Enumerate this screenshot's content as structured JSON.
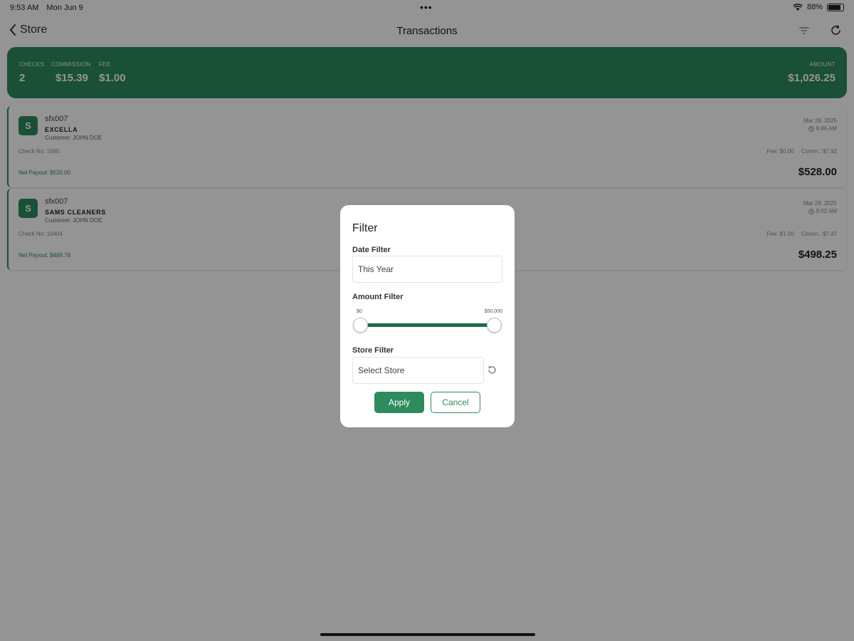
{
  "status": {
    "time": "9:53 AM",
    "date": "Mon Jun 9",
    "battery": "88%"
  },
  "nav": {
    "back_label": "Store",
    "title": "Transactions"
  },
  "summary": {
    "checks_label": "CHECKS",
    "checks": "2",
    "commission_label": "COMMISSION",
    "commission": "$15.39",
    "fee_label": "FEE",
    "fee": "$1.00",
    "amount_label": "AMOUNT",
    "amount": "$1,026.25"
  },
  "transactions": [
    {
      "avatar": "S",
      "code": "sfx007",
      "store": "EXCELLA",
      "customer": "Customer: JOHN DOE",
      "check": "Check No: 1565",
      "payout": "Net Payout: $520.00",
      "date": "Mar 28, 2025",
      "time": "9:46 AM",
      "fee": "Fee: $0.00",
      "comm": "Comm.: $7.92",
      "amount": "$528.00"
    },
    {
      "avatar": "S",
      "code": "sfx007",
      "store": "SAMS CLEANERS",
      "customer": "Customer: JOHN DOE",
      "check": "Check No: 16404",
      "payout": "Net Payout: $489.78",
      "date": "Mar 28, 2025",
      "time": "9:52 AM",
      "fee": "Fee: $1.00",
      "comm": "Comm.: $7.47",
      "amount": "$498.25"
    }
  ],
  "filter": {
    "title": "Filter",
    "date_label": "Date Filter",
    "date_value": "This Year",
    "amount_label": "Amount Filter",
    "amount_min": "$0",
    "amount_max": "$50,000",
    "store_label": "Store Filter",
    "store_placeholder": "Select Store",
    "apply_label": "Apply",
    "cancel_label": "Cancel"
  },
  "colors": {
    "brand": "#2e8b5e",
    "slider": "#1d6b46"
  },
  "icons": [
    "chevron-left-icon",
    "filter-icon",
    "refresh-icon",
    "wifi-icon",
    "battery-icon",
    "clock-icon",
    "reset-icon"
  ]
}
